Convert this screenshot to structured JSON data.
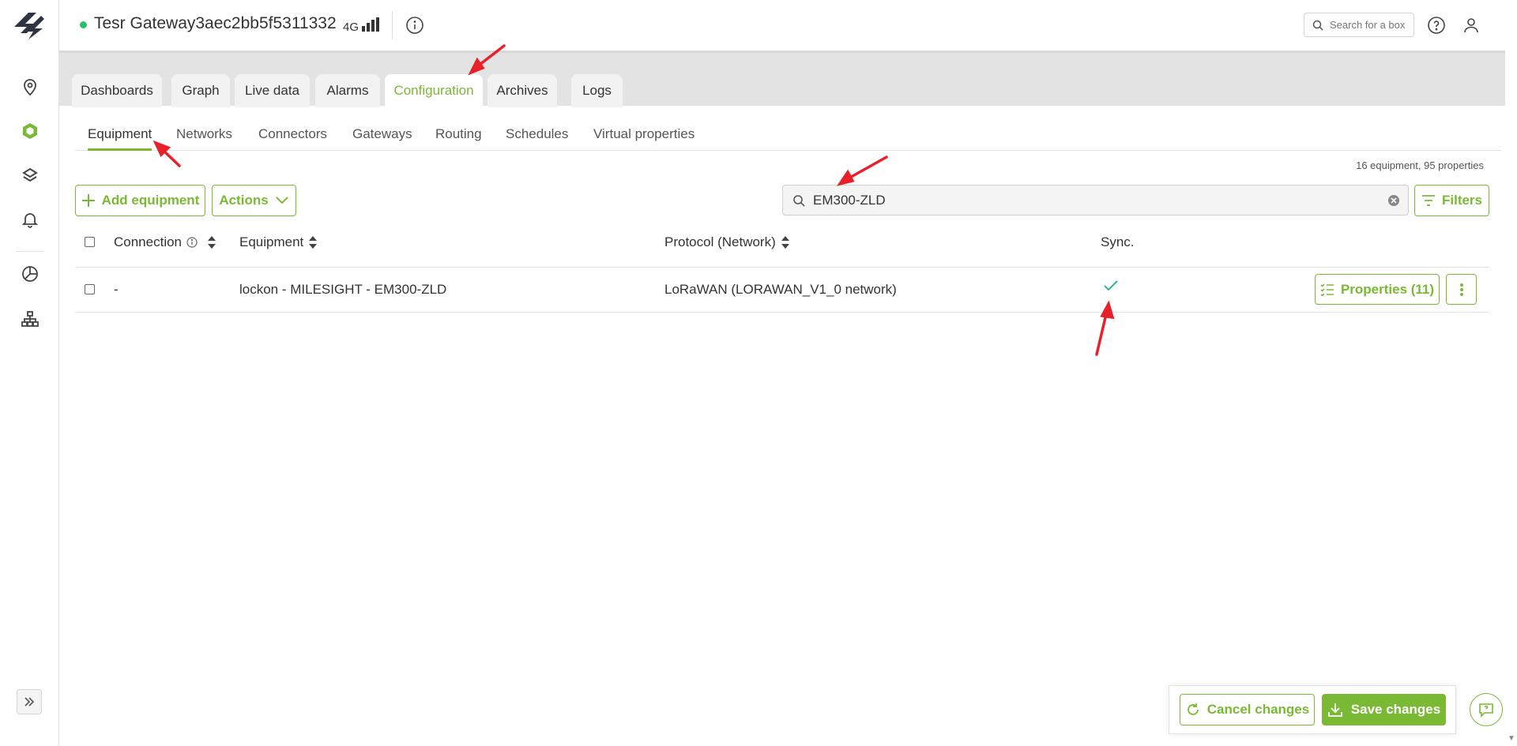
{
  "header": {
    "gateway_name": "Tesr Gateway3aec2bb5f5311332",
    "network_type": "4G",
    "search_placeholder": "Search for a box"
  },
  "main_tabs": [
    {
      "label": "Dashboards"
    },
    {
      "label": "Graph"
    },
    {
      "label": "Live data"
    },
    {
      "label": "Alarms"
    },
    {
      "label": "Configuration",
      "active": true
    },
    {
      "label": "Archives"
    },
    {
      "label": "Logs"
    }
  ],
  "sub_tabs": [
    {
      "label": "Equipment",
      "active": true
    },
    {
      "label": "Networks"
    },
    {
      "label": "Connectors"
    },
    {
      "label": "Gateways"
    },
    {
      "label": "Routing"
    },
    {
      "label": "Schedules"
    },
    {
      "label": "Virtual properties"
    }
  ],
  "summary": "16 equipment, 95 properties",
  "toolbar": {
    "add_label": "Add equipment",
    "actions_label": "Actions",
    "search_value": "EM300-ZLD",
    "filters_label": "Filters"
  },
  "table": {
    "columns": [
      "Connection",
      "Equipment",
      "Protocol (Network)",
      "Sync."
    ],
    "rows": [
      {
        "connection": "-",
        "equipment": "lockon - MILESIGHT - EM300-ZLD",
        "protocol": "LoRaWAN (LORAWAN_V1_0 network)",
        "sync": "synced",
        "properties_label": "Properties (11)"
      }
    ]
  },
  "footer": {
    "cancel_label": "Cancel changes",
    "save_label": "Save changes"
  },
  "colors": {
    "accent": "#7ab934",
    "status_online": "#2bbf6a",
    "sync_check": "#3ab58a",
    "annotation": "#e8202a"
  },
  "icons": {
    "sidebar": [
      "map-pin-icon",
      "cube-icon",
      "layers-icon",
      "bell-icon",
      "chart-icon",
      "hierarchy-icon",
      "expand-icon"
    ]
  }
}
